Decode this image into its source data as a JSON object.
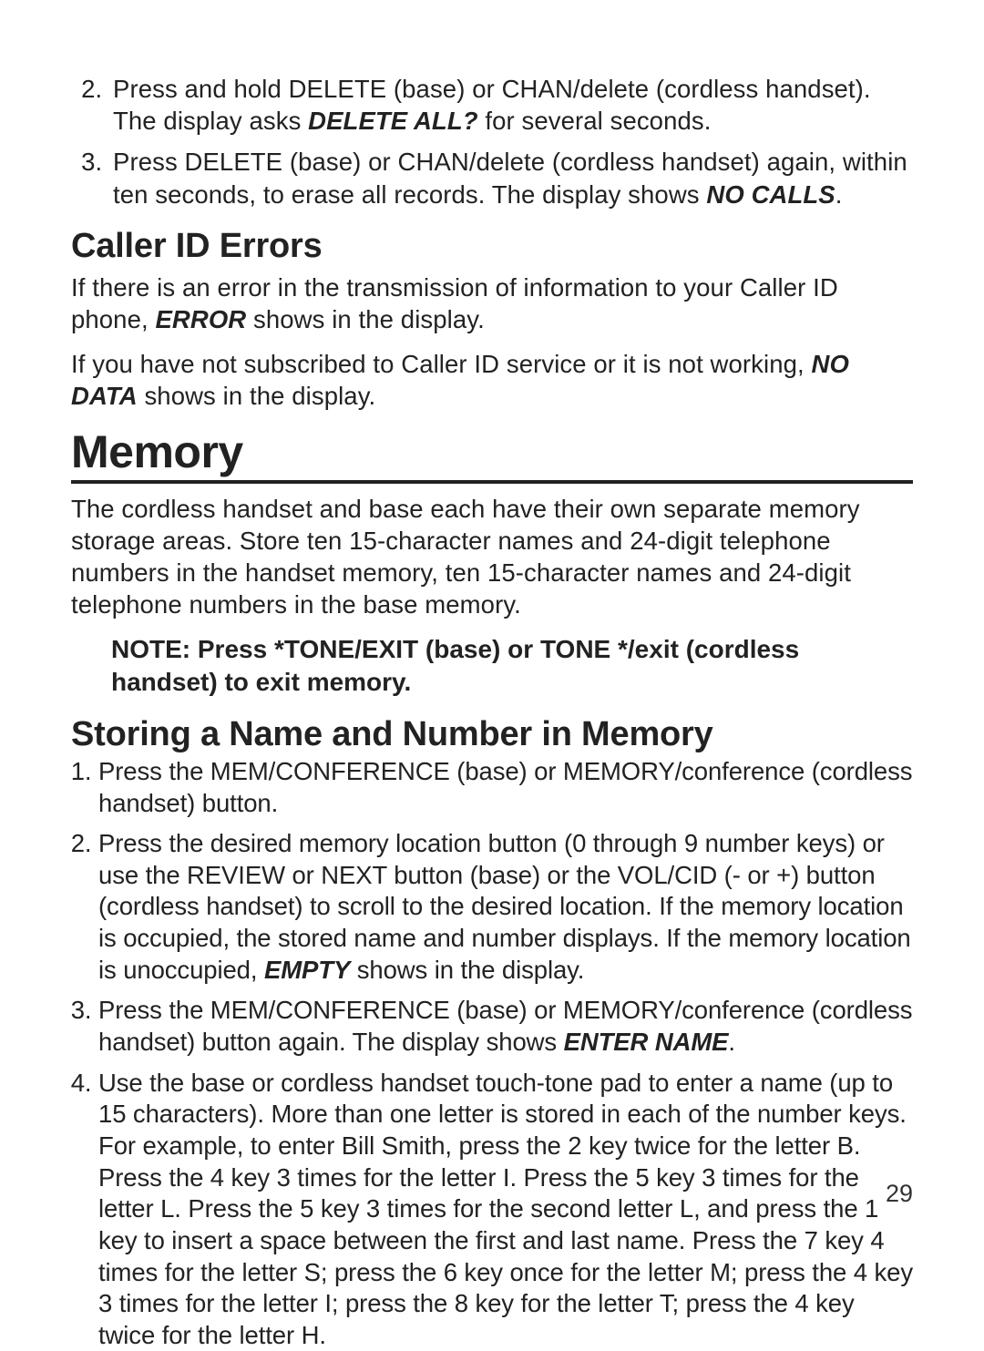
{
  "top_list": {
    "item2_a": "Press and hold DELETE (base) or CHAN/delete (cordless handset). The display asks ",
    "item2_em": "DELETE ALL?",
    "item2_b": " for several seconds.",
    "item3_a": "Press DELETE (base) or CHAN/delete (cordless handset) again, within ten seconds, to erase all records. The display shows ",
    "item3_em": "NO CALLS",
    "item3_b": "."
  },
  "caller_id": {
    "heading": "Caller ID Errors",
    "p1_a": "If there is an error in the transmission of information to your Caller ID phone, ",
    "p1_em": "ERROR",
    "p1_b": " shows in the display.",
    "p2_a": "If you have not subscribed to Caller ID service or it is not working, ",
    "p2_em": "NO DATA",
    "p2_b": " shows in the display."
  },
  "memory": {
    "heading": "Memory",
    "intro": "The cordless handset and base each have their own separate memory storage areas. Store ten 15-character names and 24-digit telephone numbers in the handset memory, ten 15-character names and 24-digit telephone numbers in the base memory.",
    "note": "NOTE: Press *TONE/EXIT (base) or TONE */exit (cordless handset) to exit memory."
  },
  "storing": {
    "heading": "Storing a Name and Number in Memory",
    "s1": "Press the MEM/CONFERENCE (base) or MEMORY/conference (cordless handset) button.",
    "s2_a": "Press the desired memory location button (0 through 9 number keys) or use the REVIEW or NEXT button (base) or the VOL/CID (- or +) button (cordless handset) to scroll to the desired location. If the memory location is occupied, the stored name and number displays. If the memory location is unoccupied, ",
    "s2_em": "EMPTY",
    "s2_b": " shows in the display.",
    "s3_a": "Press the MEM/CONFERENCE (base) or MEMORY/conference (cordless handset) button again. The display shows ",
    "s3_em": "ENTER NAME",
    "s3_b": ".",
    "s4": "Use the base or cordless handset touch-tone pad to enter a name (up to 15 characters). More than one letter is stored in each of the number keys. For example, to enter Bill Smith, press the 2 key twice for the letter B. Press the 4 key 3 times for the letter I. Press the 5 key 3 times for the letter L. Press the 5 key 3 times for the second letter L, and press the 1 key to insert a space between the first and last name. Press the 7 key 4 times for the letter S; press the 6 key once for the letter M; press the 4 key 3 times for the letter I; press the 8 key for the letter T; press the 4 key twice for the letter H."
  },
  "page_number": "29"
}
